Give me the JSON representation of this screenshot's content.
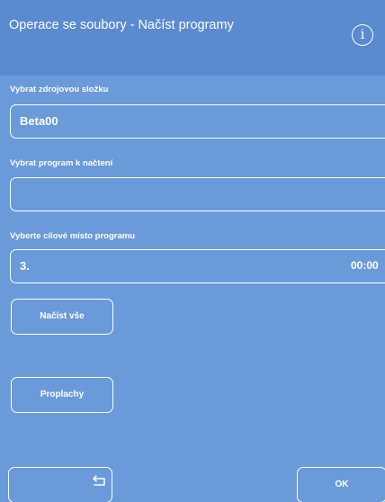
{
  "header": {
    "title": "Operace se soubory - Načíst programy",
    "info_icon": "info-icon",
    "info_label": "i"
  },
  "source_folder": {
    "label": "Vybrat zdrojovou složku",
    "value": "Beta00"
  },
  "program": {
    "label": "Vybrat program k načtení",
    "value": ""
  },
  "destination": {
    "label": "Vyberte cílové místo programu",
    "value": "3.",
    "time": "00:00"
  },
  "buttons": {
    "load_all": "Načíst vše",
    "rinses": "Proplachy",
    "back_icon": "back-arrow-icon",
    "ok": "OK"
  },
  "colors": {
    "background": "#6a9ad9",
    "header": "#5a8ad0",
    "foreground": "#ffffff"
  }
}
